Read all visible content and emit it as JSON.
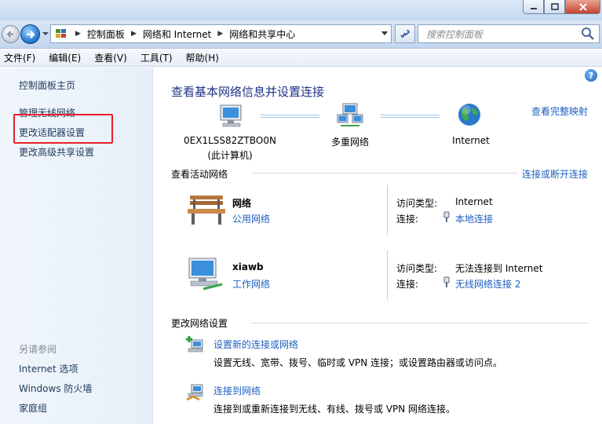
{
  "window": {
    "buttons": {
      "minimize": "minimize-icon",
      "maximize": "maximize-icon",
      "close": "close-icon"
    }
  },
  "address_bar": {
    "breadcrumbs": [
      "控制面板",
      "网络和 Internet",
      "网络和共享中心"
    ],
    "search_placeholder": "搜索控制面板"
  },
  "menu": {
    "items": [
      "文件(F)",
      "编辑(E)",
      "查看(V)",
      "工具(T)",
      "帮助(H)"
    ]
  },
  "sidebar": {
    "links": [
      "控制面板主页",
      "管理无线网络",
      "更改适配器设置",
      "更改高级共享设置"
    ],
    "see_also_title": "另请参阅",
    "see_also": [
      "Internet 选项",
      "Windows 防火墙",
      "家庭组"
    ],
    "highlight_color": "#e9202a"
  },
  "main": {
    "title": "查看基本网络信息并设置连接",
    "full_map_link": "查看完整映射",
    "map": {
      "computer_name": "0EX1LSS82ZTBO0N",
      "computer_sub": "(此计算机)",
      "middle": "多重网络",
      "right": "Internet"
    },
    "active": {
      "header": "查看活动网络",
      "link": "连接或断开连接",
      "networks": [
        {
          "name": "网络",
          "type": "公用网络",
          "access_label": "访问类型:",
          "access_value": "Internet",
          "conn_label": "连接:",
          "conn_value": "本地连接"
        },
        {
          "name": "xiawb",
          "type": "工作网络",
          "access_label": "访问类型:",
          "access_value": "无法连接到 Internet",
          "conn_label": "连接:",
          "conn_value": "无线网络连接 2"
        }
      ]
    },
    "change": {
      "header": "更改网络设置",
      "tasks": [
        {
          "title": "设置新的连接或网络",
          "desc": "设置无线、宽带、拨号、临时或 VPN 连接；或设置路由器或访问点。"
        },
        {
          "title": "连接到网络",
          "desc": "连接到或重新连接到无线、有线、拨号或 VPN 网络连接。"
        }
      ]
    }
  }
}
